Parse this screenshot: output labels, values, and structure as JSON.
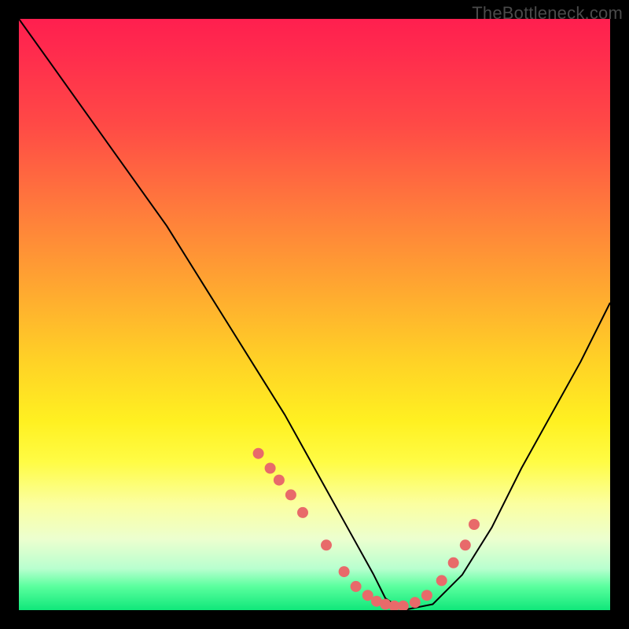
{
  "watermark": "TheBottleneck.com",
  "colors": {
    "frame": "#000000",
    "curve_stroke": "#000000",
    "dot_fill": "#e86a6a",
    "gradient_stops": [
      "#ff1f4f",
      "#ff2c4d",
      "#ff4a46",
      "#ff7a3c",
      "#ffa930",
      "#ffd226",
      "#fff021",
      "#fffc45",
      "#fbffa0",
      "#ecffcf",
      "#b8ffcf",
      "#5aff9e",
      "#10e77a"
    ]
  },
  "chart_data": {
    "type": "line",
    "title": "",
    "xlabel": "",
    "ylabel": "",
    "x_range": [
      0,
      100
    ],
    "y_range": [
      0,
      100
    ],
    "series": [
      {
        "name": "bottleneck-curve",
        "x": [
          0,
          5,
          10,
          15,
          20,
          25,
          30,
          35,
          40,
          45,
          50,
          55,
          60,
          62,
          65,
          70,
          75,
          80,
          85,
          90,
          95,
          100
        ],
        "y": [
          100,
          93,
          86,
          79,
          72,
          65,
          57,
          49,
          41,
          33,
          24,
          15,
          6,
          2,
          0,
          1,
          6,
          14,
          24,
          33,
          42,
          52
        ]
      }
    ],
    "markers": [
      {
        "name": "highlight-dots",
        "x": [
          40.5,
          42.5,
          44,
          46,
          48,
          52,
          55,
          57,
          59,
          60.5,
          62,
          63.5,
          65,
          67,
          69,
          71.5,
          73.5,
          75.5,
          77
        ],
        "y": [
          26.5,
          24,
          22,
          19.5,
          16.5,
          11,
          6.5,
          4,
          2.5,
          1.5,
          1,
          0.7,
          0.7,
          1.3,
          2.5,
          5,
          8,
          11,
          14.5
        ]
      }
    ]
  }
}
